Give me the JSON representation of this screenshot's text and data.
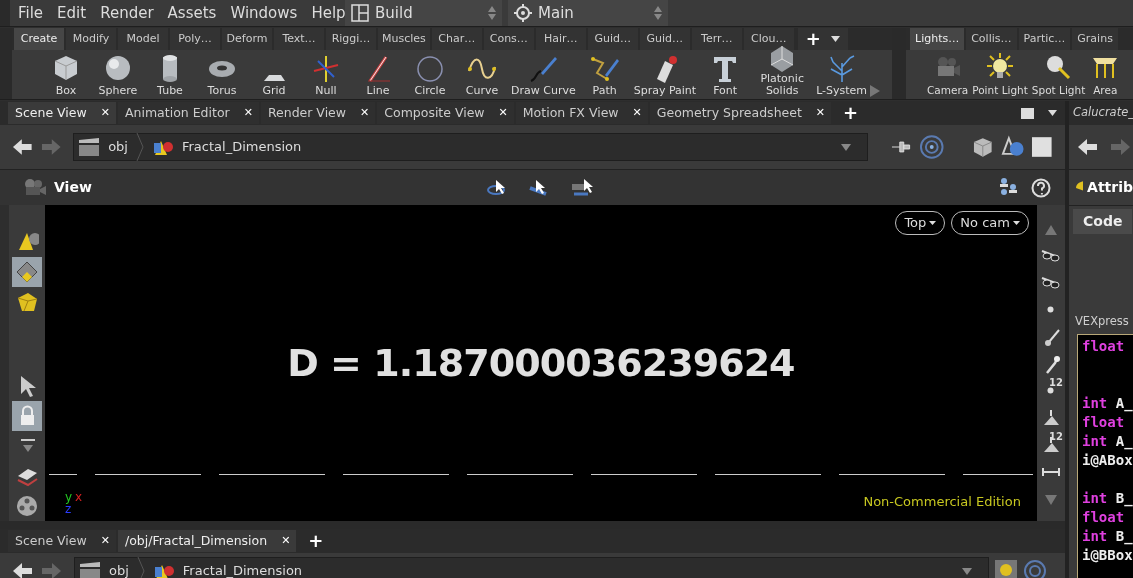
{
  "menu": [
    "File",
    "Edit",
    "Render",
    "Assets",
    "Windows",
    "Help"
  ],
  "desktop": {
    "label": "Build"
  },
  "context": {
    "label": "Main"
  },
  "shelf_tabs": [
    {
      "label": "Create",
      "selected": true
    },
    {
      "label": "Modify",
      "selected": false
    },
    {
      "label": "Model",
      "selected": false
    },
    {
      "label": "Poly…",
      "selected": false
    },
    {
      "label": "Deform",
      "selected": false
    },
    {
      "label": "Text…",
      "selected": false
    },
    {
      "label": "Riggi…",
      "selected": false
    },
    {
      "label": "Muscles",
      "selected": false
    },
    {
      "label": "Char…",
      "selected": false
    },
    {
      "label": "Cons…",
      "selected": false
    },
    {
      "label": "Hair…",
      "selected": false
    },
    {
      "label": "Guid…",
      "selected": false
    },
    {
      "label": "Guid…",
      "selected": false
    },
    {
      "label": "Terr…",
      "selected": false
    },
    {
      "label": "Clou…",
      "selected": false
    }
  ],
  "shelf_tools": [
    {
      "kind": "box",
      "label": "Box"
    },
    {
      "kind": "sphere",
      "label": "Sphere"
    },
    {
      "kind": "tube",
      "label": "Tube"
    },
    {
      "kind": "torus",
      "label": "Torus"
    },
    {
      "kind": "grid",
      "label": "Grid"
    },
    {
      "kind": "null",
      "label": "Null"
    },
    {
      "kind": "line",
      "label": "Line"
    },
    {
      "kind": "circle",
      "label": "Circle"
    },
    {
      "kind": "curve",
      "label": "Curve"
    },
    {
      "kind": "pen",
      "label": "Draw Curve"
    },
    {
      "kind": "path",
      "label": "Path"
    },
    {
      "kind": "spray",
      "label": "Spray Paint"
    },
    {
      "kind": "font",
      "label": "Font"
    },
    {
      "kind": "solid",
      "label": "Platonic Solids"
    },
    {
      "kind": "tree",
      "label": "L-System"
    }
  ],
  "right_shelf_tabs": [
    {
      "label": "Lights…",
      "selected": true
    },
    {
      "label": "Collis…",
      "selected": false
    },
    {
      "label": "Partic…",
      "selected": false
    },
    {
      "label": "Grains",
      "selected": false
    }
  ],
  "shelf_add": "+",
  "right_shelf_tools": [
    {
      "kind": "camera",
      "label": "Camera"
    },
    {
      "kind": "bulb",
      "label": "Point Light"
    },
    {
      "kind": "spot",
      "label": "Spot Light"
    },
    {
      "kind": "area",
      "label": "Area"
    }
  ],
  "pane_add": "+",
  "pane_tabs": [
    {
      "label": "Scene View",
      "selected": true,
      "close": "✕"
    },
    {
      "label": "Animation Editor",
      "selected": false,
      "close": "✕"
    },
    {
      "label": "Render View",
      "selected": false,
      "close": "✕"
    },
    {
      "label": "Composite View",
      "selected": false,
      "close": "✕"
    },
    {
      "label": "Motion FX View",
      "selected": false,
      "close": "✕"
    },
    {
      "label": "Geometry Spreadsheet",
      "selected": false,
      "close": "✕"
    }
  ],
  "path": {
    "network": "obj",
    "node": "Fractal_Dimension"
  },
  "viewport": {
    "title": "View",
    "view_menu": "Top",
    "camera_menu": "No cam",
    "overlay_text": "D = 1.187000036239624",
    "edition": "Non-Commercial Edition",
    "axes": [
      {
        "label": "y",
        "color": "#22c822"
      },
      {
        "label": "x",
        "color": "#d42020"
      },
      {
        "label": "z",
        "color": "#2a3cff"
      }
    ],
    "left_tools": [
      {
        "kind": "cone",
        "selected": false
      },
      {
        "kind": "diamond",
        "selected": true
      },
      {
        "kind": "cube",
        "selected": false
      },
      {
        "kind": "arrow",
        "selected": false
      },
      {
        "kind": "lock",
        "selected": true
      },
      {
        "kind": "drop",
        "selected": false
      },
      {
        "kind": "layers",
        "selected": false
      },
      {
        "kind": "reel",
        "selected": false
      }
    ],
    "right_tools": [
      {
        "kind": "up"
      },
      {
        "kind": "glasses"
      },
      {
        "kind": "glasses"
      },
      {
        "kind": "dot"
      },
      {
        "kind": "brush"
      },
      {
        "kind": "pin"
      },
      {
        "kind": "dot",
        "label": "12"
      },
      {
        "kind": "bucket"
      },
      {
        "kind": "bucket",
        "label": "12"
      },
      {
        "kind": "measure"
      },
      {
        "kind": "down"
      }
    ]
  },
  "lower_pane": {
    "add": "+",
    "tabs": [
      {
        "label": "Scene View",
        "selected": false,
        "close": "✕"
      },
      {
        "label": "/obj/Fractal_Dimension",
        "selected": true,
        "close": "✕"
      }
    ],
    "path": {
      "network": "obj",
      "node": "Fractal_Dimension"
    }
  },
  "side_pane": {
    "title": "Calucrate_",
    "header": "Attrib",
    "tabs": [
      {
        "label": "Code",
        "selected": true
      }
    ],
    "field_label": "VEXpress",
    "code": [
      {
        "kind": "code",
        "keyword": "float"
      },
      {
        "kind": "blank"
      },
      {
        "kind": "blank"
      },
      {
        "kind": "code",
        "keyword": "int",
        "rest": "A_"
      },
      {
        "kind": "code",
        "keyword": "float"
      },
      {
        "kind": "code",
        "keyword": "int",
        "rest": "A_"
      },
      {
        "kind": "code",
        "rest": "i@ABox"
      },
      {
        "kind": "blank"
      },
      {
        "kind": "code",
        "keyword": "int",
        "rest": "B_"
      },
      {
        "kind": "code",
        "keyword": "float"
      },
      {
        "kind": "code",
        "keyword": "int",
        "rest": "B_"
      },
      {
        "kind": "code",
        "rest": "i@BBox"
      }
    ]
  }
}
